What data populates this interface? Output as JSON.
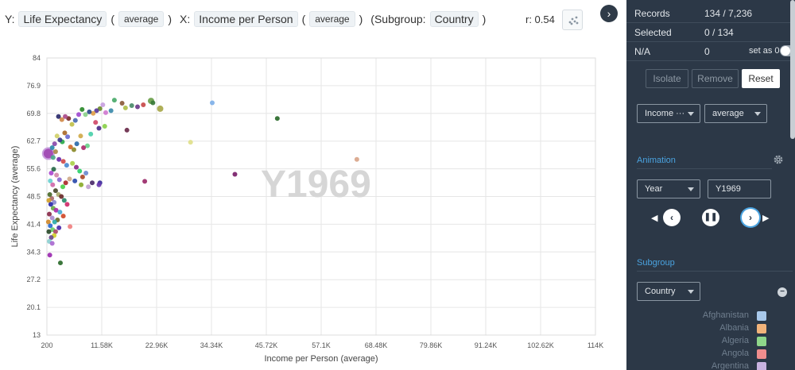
{
  "header": {
    "y_prefix": "Y:",
    "y_measure": "Life Expectancy",
    "y_agg": "average",
    "x_prefix": "X:",
    "x_measure": "Income per Person",
    "x_agg": "average",
    "subgroup_prefix": "(Subgroup:",
    "subgroup_value": "Country",
    "subgroup_suffix": ")",
    "r_value": "r: 0.54",
    "collapse_icon": "chevron-right-icon"
  },
  "sidebar": {
    "records_label": "Records",
    "records_value": "134 / 7,236",
    "selected_label": "Selected",
    "selected_value": "0 / 134",
    "na_label": "N/A",
    "na_value": "0",
    "set_as_zero_label": "set as 0",
    "isolate_label": "Isolate",
    "remove_label": "Remove",
    "reset_label": "Reset",
    "measure_select": "Income ···",
    "agg_select": "average",
    "animation_title": "Animation",
    "anim_field": "Year",
    "anim_value": "Y1969",
    "subgroup_title": "Subgroup",
    "subgroup_field": "Country",
    "legend": [
      {
        "label": "Afghanistan",
        "color": "#a8c8ea"
      },
      {
        "label": "Albania",
        "color": "#f2b37a"
      },
      {
        "label": "Algeria",
        "color": "#8fd68a"
      },
      {
        "label": "Angola",
        "color": "#f08d8d"
      },
      {
        "label": "Argentina",
        "color": "#c9b3e0"
      }
    ]
  },
  "chart_data": {
    "type": "scatter",
    "title": "",
    "xlabel": "Income per Person (average)",
    "ylabel": "Life Expectancy (average)",
    "watermark": "Y1969",
    "xlim": [
      200,
      114000
    ],
    "ylim": [
      13,
      84
    ],
    "x_ticks": [
      "200",
      "11.58K",
      "22.96K",
      "34.34K",
      "45.72K",
      "57.1K",
      "68.48K",
      "79.86K",
      "91.24K",
      "102.62K",
      "114K"
    ],
    "y_ticks": [
      "84",
      "76.9",
      "69.8",
      "62.7",
      "55.6",
      "48.5",
      "41.4",
      "34.3",
      "27.2",
      "20.1",
      "13"
    ],
    "grid": true,
    "points": [
      {
        "x": 500,
        "y": 59.5,
        "r": 7,
        "color": "#9b3fb0"
      },
      {
        "x": 34500,
        "y": 72.5,
        "r": 3,
        "color": "#7fb0e8"
      },
      {
        "x": 48000,
        "y": 68.5,
        "r": 3,
        "color": "#2a6a2a"
      },
      {
        "x": 30000,
        "y": 62.4,
        "r": 3,
        "color": "#e0e08a"
      },
      {
        "x": 39200,
        "y": 54.2,
        "r": 3,
        "color": "#7a1f6a"
      },
      {
        "x": 64500,
        "y": 58.0,
        "r": 3,
        "color": "#d9a58a"
      },
      {
        "x": 20500,
        "y": 52.4,
        "r": 3,
        "color": "#9b2a6a"
      },
      {
        "x": 5000,
        "y": 40.8,
        "r": 3,
        "color": "#f08080"
      },
      {
        "x": 3000,
        "y": 31.5,
        "r": 3,
        "color": "#2a6a2a"
      },
      {
        "x": 800,
        "y": 33.5,
        "r": 3,
        "color": "#9b2ab0"
      },
      {
        "x": 23700,
        "y": 71.0,
        "r": 4,
        "color": "#a8a84a"
      },
      {
        "x": 21800,
        "y": 73.0,
        "r": 4,
        "color": "#6aa04a"
      },
      {
        "x": 22200,
        "y": 72.5,
        "r": 3,
        "color": "#3a7a3a"
      },
      {
        "x": 20200,
        "y": 72.0,
        "r": 3,
        "color": "#c84a4a"
      },
      {
        "x": 19000,
        "y": 71.5,
        "r": 3,
        "color": "#6a3a8a"
      },
      {
        "x": 17800,
        "y": 71.8,
        "r": 3,
        "color": "#4a8a6a"
      },
      {
        "x": 16500,
        "y": 71.2,
        "r": 3,
        "color": "#b0c04a"
      },
      {
        "x": 15800,
        "y": 72.4,
        "r": 3,
        "color": "#8a5a3a"
      },
      {
        "x": 14200,
        "y": 73.2,
        "r": 3,
        "color": "#4aaa6a"
      },
      {
        "x": 13500,
        "y": 70.5,
        "r": 3,
        "color": "#3a8aaa"
      },
      {
        "x": 12400,
        "y": 70.0,
        "r": 3,
        "color": "#d07ad0"
      },
      {
        "x": 11800,
        "y": 72.0,
        "r": 3,
        "color": "#c8a0e0"
      },
      {
        "x": 11200,
        "y": 71.0,
        "r": 3,
        "color": "#6a8a2a"
      },
      {
        "x": 10500,
        "y": 70.5,
        "r": 3,
        "color": "#5a3a9a"
      },
      {
        "x": 9800,
        "y": 69.8,
        "r": 3,
        "color": "#e0a04a"
      },
      {
        "x": 9000,
        "y": 70.2,
        "r": 3,
        "color": "#2a4a8a"
      },
      {
        "x": 8200,
        "y": 69.5,
        "r": 3,
        "color": "#8ad08a"
      },
      {
        "x": 7500,
        "y": 70.8,
        "r": 3,
        "color": "#2a8a2a"
      },
      {
        "x": 6800,
        "y": 69.5,
        "r": 3,
        "color": "#a04ad0"
      },
      {
        "x": 6100,
        "y": 68.0,
        "r": 3,
        "color": "#4a6ab0"
      },
      {
        "x": 5400,
        "y": 67.0,
        "r": 3,
        "color": "#c0c04a"
      },
      {
        "x": 4700,
        "y": 68.5,
        "r": 3,
        "color": "#7a2a2a"
      },
      {
        "x": 4000,
        "y": 69.0,
        "r": 3,
        "color": "#aa4a8a"
      },
      {
        "x": 3300,
        "y": 68.2,
        "r": 3,
        "color": "#d08a4a"
      },
      {
        "x": 2600,
        "y": 69.0,
        "r": 3,
        "color": "#2a2a6a"
      },
      {
        "x": 12200,
        "y": 66.5,
        "r": 3,
        "color": "#8ad04a"
      },
      {
        "x": 11000,
        "y": 66.0,
        "r": 3,
        "color": "#4a2a8a"
      },
      {
        "x": 10300,
        "y": 67.5,
        "r": 3,
        "color": "#d04a6a"
      },
      {
        "x": 16800,
        "y": 65.5,
        "r": 3,
        "color": "#6a2a4a"
      },
      {
        "x": 9300,
        "y": 64.5,
        "r": 3,
        "color": "#4ad0aa"
      },
      {
        "x": 7200,
        "y": 64.0,
        "r": 3,
        "color": "#d0aa4a"
      },
      {
        "x": 8600,
        "y": 61.5,
        "r": 3,
        "color": "#6ad08a"
      },
      {
        "x": 7800,
        "y": 61.0,
        "r": 3,
        "color": "#aa2a6a"
      },
      {
        "x": 6400,
        "y": 62.0,
        "r": 3,
        "color": "#2a6aaa"
      },
      {
        "x": 5800,
        "y": 60.5,
        "r": 3,
        "color": "#8a8a2a"
      },
      {
        "x": 5100,
        "y": 61.2,
        "r": 3,
        "color": "#d06a2a"
      },
      {
        "x": 4500,
        "y": 63.8,
        "r": 3,
        "color": "#6a6ad0"
      },
      {
        "x": 3900,
        "y": 64.8,
        "r": 3,
        "color": "#aa6a2a"
      },
      {
        "x": 3400,
        "y": 62.5,
        "r": 3,
        "color": "#2aaa4a"
      },
      {
        "x": 2900,
        "y": 63.0,
        "r": 3,
        "color": "#3a3a8a"
      },
      {
        "x": 2300,
        "y": 64.0,
        "r": 3,
        "color": "#d0d06a"
      },
      {
        "x": 1800,
        "y": 62.0,
        "r": 3,
        "color": "#8a4aaa"
      },
      {
        "x": 1300,
        "y": 61.0,
        "r": 3,
        "color": "#2a8aaa"
      },
      {
        "x": 2000,
        "y": 60.0,
        "r": 3,
        "color": "#aa8a4a"
      },
      {
        "x": 1500,
        "y": 58.5,
        "r": 3,
        "color": "#4aaa8a"
      },
      {
        "x": 2700,
        "y": 58.0,
        "r": 3,
        "color": "#6a2aaa"
      },
      {
        "x": 3600,
        "y": 57.5,
        "r": 3,
        "color": "#d04a4a"
      },
      {
        "x": 4300,
        "y": 56.5,
        "r": 3,
        "color": "#4a8ad0"
      },
      {
        "x": 5500,
        "y": 57.0,
        "r": 3,
        "color": "#aad04a"
      },
      {
        "x": 6300,
        "y": 56.0,
        "r": 3,
        "color": "#8a2a8a"
      },
      {
        "x": 7000,
        "y": 55.0,
        "r": 3,
        "color": "#2ad06a"
      },
      {
        "x": 7600,
        "y": 53.5,
        "r": 3,
        "color": "#aa4a2a"
      },
      {
        "x": 8300,
        "y": 54.5,
        "r": 3,
        "color": "#6a8ad0"
      },
      {
        "x": 9600,
        "y": 52.0,
        "r": 3,
        "color": "#4a2a6a"
      },
      {
        "x": 11200,
        "y": 52.0,
        "r": 3,
        "color": "#3a2a9a"
      },
      {
        "x": 11000,
        "y": 51.5,
        "r": 3,
        "color": "#6a3ab0"
      },
      {
        "x": 8800,
        "y": 51.0,
        "r": 3,
        "color": "#c0a0d0"
      },
      {
        "x": 7300,
        "y": 51.5,
        "r": 3,
        "color": "#8aaa2a"
      },
      {
        "x": 6000,
        "y": 52.5,
        "r": 3,
        "color": "#2a4aaa"
      },
      {
        "x": 4900,
        "y": 53.0,
        "r": 3,
        "color": "#d0aa8a"
      },
      {
        "x": 4100,
        "y": 52.0,
        "r": 3,
        "color": "#aa2a2a"
      },
      {
        "x": 3500,
        "y": 51.0,
        "r": 3,
        "color": "#4ad04a"
      },
      {
        "x": 2800,
        "y": 52.8,
        "r": 3,
        "color": "#8a6ad0"
      },
      {
        "x": 2200,
        "y": 54.0,
        "r": 3,
        "color": "#d08aaa"
      },
      {
        "x": 1600,
        "y": 55.5,
        "r": 3,
        "color": "#2a6a4a"
      },
      {
        "x": 1100,
        "y": 54.5,
        "r": 3,
        "color": "#aa4ad0"
      },
      {
        "x": 900,
        "y": 52.5,
        "r": 3,
        "color": "#6ad0d0"
      },
      {
        "x": 1400,
        "y": 51.5,
        "r": 3,
        "color": "#d06aaa"
      },
      {
        "x": 2000,
        "y": 50.0,
        "r": 3,
        "color": "#4a4a2a"
      },
      {
        "x": 2600,
        "y": 49.0,
        "r": 3,
        "color": "#aaaa6a"
      },
      {
        "x": 3200,
        "y": 48.5,
        "r": 3,
        "color": "#6a2a2a"
      },
      {
        "x": 3800,
        "y": 47.5,
        "r": 3,
        "color": "#2a8a6a"
      },
      {
        "x": 4400,
        "y": 46.5,
        "r": 3,
        "color": "#d02a6a"
      },
      {
        "x": 1700,
        "y": 47.0,
        "r": 3,
        "color": "#8a8ad0"
      },
      {
        "x": 1200,
        "y": 48.0,
        "r": 3,
        "color": "#aa6a6a"
      },
      {
        "x": 800,
        "y": 49.0,
        "r": 3,
        "color": "#4a6a2a"
      },
      {
        "x": 600,
        "y": 47.5,
        "r": 3,
        "color": "#d0a02a"
      },
      {
        "x": 1000,
        "y": 46.5,
        "r": 3,
        "color": "#2a2aaa"
      },
      {
        "x": 1500,
        "y": 45.5,
        "r": 3,
        "color": "#6aaa4a"
      },
      {
        "x": 2100,
        "y": 45.0,
        "r": 3,
        "color": "#aa2aaa"
      },
      {
        "x": 2900,
        "y": 44.5,
        "r": 3,
        "color": "#4aaad0"
      },
      {
        "x": 3600,
        "y": 43.5,
        "r": 3,
        "color": "#d04a2a"
      },
      {
        "x": 2400,
        "y": 42.5,
        "r": 3,
        "color": "#6a6a2a"
      },
      {
        "x": 1800,
        "y": 42.0,
        "r": 3,
        "color": "#2aaaaa"
      },
      {
        "x": 1300,
        "y": 43.0,
        "r": 3,
        "color": "#aa8ad0"
      },
      {
        "x": 700,
        "y": 44.0,
        "r": 3,
        "color": "#8a2a4a"
      },
      {
        "x": 500,
        "y": 42.0,
        "r": 3,
        "color": "#d08a2a"
      },
      {
        "x": 900,
        "y": 41.0,
        "r": 3,
        "color": "#2a6ad0"
      },
      {
        "x": 1400,
        "y": 40.0,
        "r": 3,
        "color": "#6ad06a"
      },
      {
        "x": 2000,
        "y": 39.5,
        "r": 3,
        "color": "#aa4a6a"
      },
      {
        "x": 2700,
        "y": 40.5,
        "r": 3,
        "color": "#4a2aaa"
      },
      {
        "x": 1700,
        "y": 38.5,
        "r": 3,
        "color": "#d0d02a"
      },
      {
        "x": 1100,
        "y": 38.0,
        "r": 3,
        "color": "#6a4a8a"
      },
      {
        "x": 700,
        "y": 37.0,
        "r": 3,
        "color": "#8ad0d0"
      },
      {
        "x": 1300,
        "y": 36.5,
        "r": 3,
        "color": "#aa6ad0"
      },
      {
        "x": 600,
        "y": 39.5,
        "r": 3,
        "color": "#2a4a2a"
      }
    ]
  }
}
